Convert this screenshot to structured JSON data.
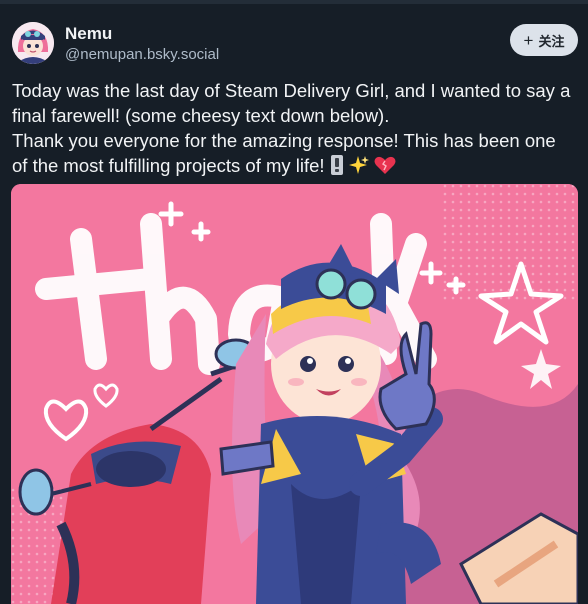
{
  "post": {
    "author": {
      "display_name": "Nemu",
      "handle": "@nemupan.bsky.social"
    },
    "follow_button": {
      "label": "关注",
      "icon": "plus-icon"
    },
    "text_line1": "Today was the last day of Steam Delivery Girl, and I wanted to say a final farewell! (some cheesy text down below).",
    "text_line2": "Thank you everyone for the amazing response! This has been one of the most fulfilling projects of my life!",
    "emojis": [
      "exclamation-emoji",
      "sparkles-emoji",
      "heart-emoji"
    ],
    "image": {
      "description_icon": "illustration-image",
      "lettering": "thank"
    }
  },
  "colors": {
    "background": "#161e27",
    "illustration_pink": "#f3779f",
    "follow_button_bg": "#dce2ea"
  }
}
